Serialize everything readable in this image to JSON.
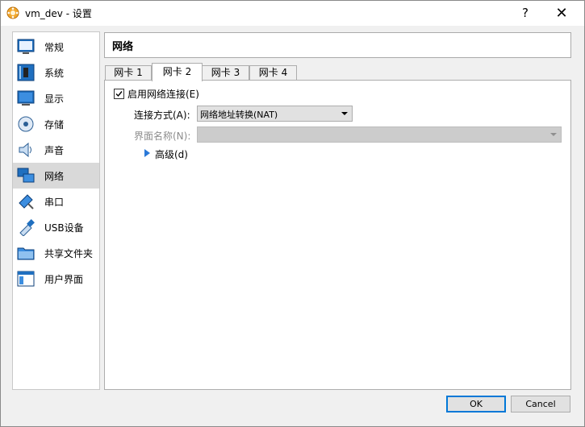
{
  "window": {
    "title": "vm_dev - 设置",
    "help_label": "?",
    "close_label": "✕"
  },
  "sidebar": {
    "items": [
      {
        "label": "常规",
        "icon": "general-icon"
      },
      {
        "label": "系统",
        "icon": "system-icon"
      },
      {
        "label": "显示",
        "icon": "display-icon"
      },
      {
        "label": "存储",
        "icon": "storage-icon"
      },
      {
        "label": "声音",
        "icon": "audio-icon"
      },
      {
        "label": "网络",
        "icon": "network-icon",
        "selected": true
      },
      {
        "label": "串口",
        "icon": "serial-port-icon"
      },
      {
        "label": "USB设备",
        "icon": "usb-icon"
      },
      {
        "label": "共享文件夹",
        "icon": "shared-folder-icon"
      },
      {
        "label": "用户界面",
        "icon": "user-interface-icon"
      }
    ]
  },
  "main": {
    "title": "网络",
    "tabs": [
      {
        "label": "网卡 1"
      },
      {
        "label": "网卡 2",
        "active": true
      },
      {
        "label": "网卡 3"
      },
      {
        "label": "网卡 4"
      }
    ],
    "enable_label": "启用网络连接(E)",
    "enable_checked": true,
    "attached_label": "连接方式(A):",
    "attached_value": "网络地址转换(NAT)",
    "name_label": "界面名称(N):",
    "name_value": "",
    "advanced_label": "高级(d)"
  },
  "buttons": {
    "ok_label": "OK",
    "cancel_label": "Cancel"
  },
  "colors": {
    "accent": "#0078d7",
    "selected_bg": "#d9d9d9",
    "expander": "#2a79d8"
  }
}
